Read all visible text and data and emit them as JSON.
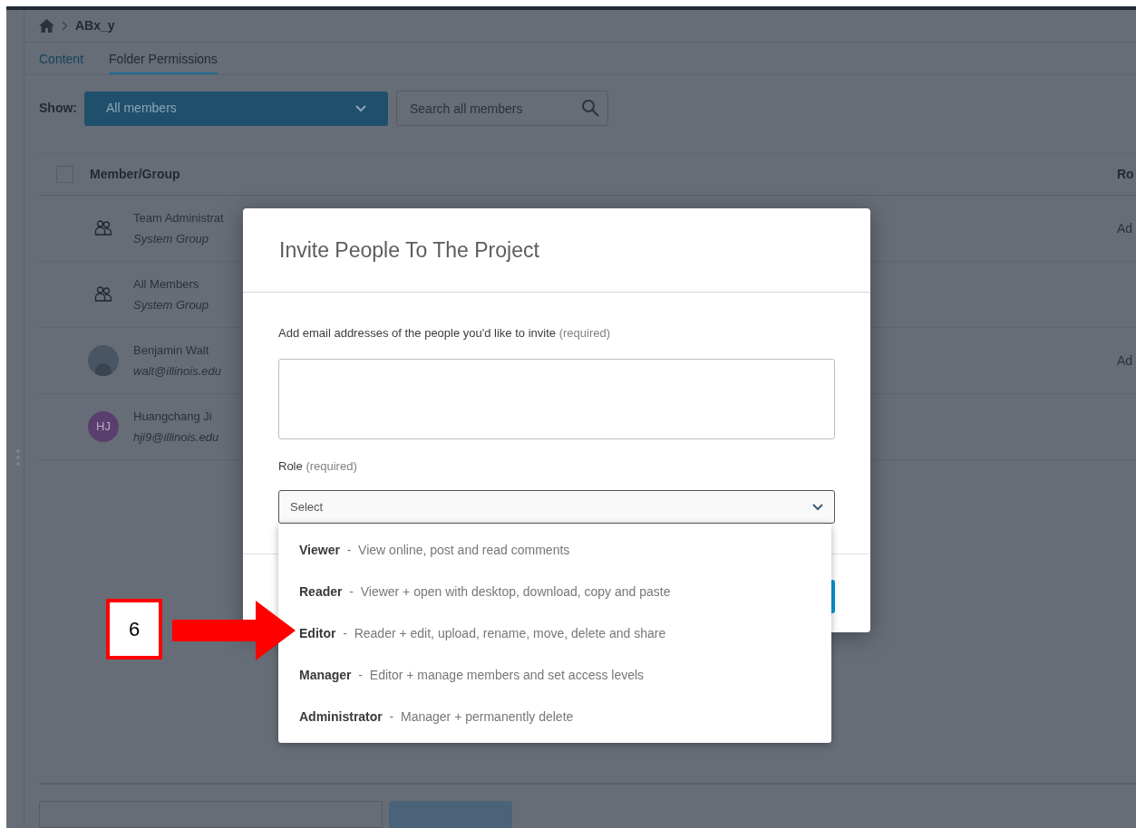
{
  "breadcrumb": {
    "current": "ABx_y"
  },
  "tabs": [
    {
      "label": "Content",
      "selected": false
    },
    {
      "label": "Folder Permissions",
      "selected": true
    }
  ],
  "filter": {
    "label": "Show:",
    "value": "All members"
  },
  "search": {
    "placeholder": "Search all members"
  },
  "table": {
    "select_all": {
      "checked": false
    },
    "columns": [
      "Member/Group",
      "Ro"
    ],
    "rows": [
      {
        "kind": "group",
        "name": "Team Administrat",
        "detail": "System Group",
        "role": "Ad"
      },
      {
        "kind": "group",
        "name": "All Members",
        "detail": "System Group"
      },
      {
        "kind": "photo",
        "name": "Benjamin Walt",
        "detail": "walt@illinois.edu",
        "role": "Ad"
      },
      {
        "kind": "initials",
        "initials": "HJ",
        "name": "Huangchang Ji",
        "detail": "hji9@illinois.edu"
      }
    ]
  },
  "modal": {
    "title": "Invite People To The Project",
    "email_label": "Add email addresses of the people you'd like to invite",
    "email_note": "(required)",
    "role_label": "Role",
    "role_note": "(required)",
    "role_select": {
      "placeholder": "Select",
      "expanded": true
    },
    "role_options": [
      {
        "name": "Viewer",
        "separator": "-",
        "description": "View online, post and read comments"
      },
      {
        "name": "Reader",
        "separator": "-",
        "description": "Viewer + open with desktop, download, copy and paste"
      },
      {
        "name": "Editor",
        "separator": "-",
        "description": "Reader + edit, upload, rename, move, delete and share"
      },
      {
        "name": "Manager",
        "separator": "-",
        "description": "Editor + manage members and set access levels"
      },
      {
        "name": "Administrator",
        "separator": "-",
        "description": "Manager + permanently delete"
      }
    ]
  },
  "annotation": {
    "label": "6"
  }
}
